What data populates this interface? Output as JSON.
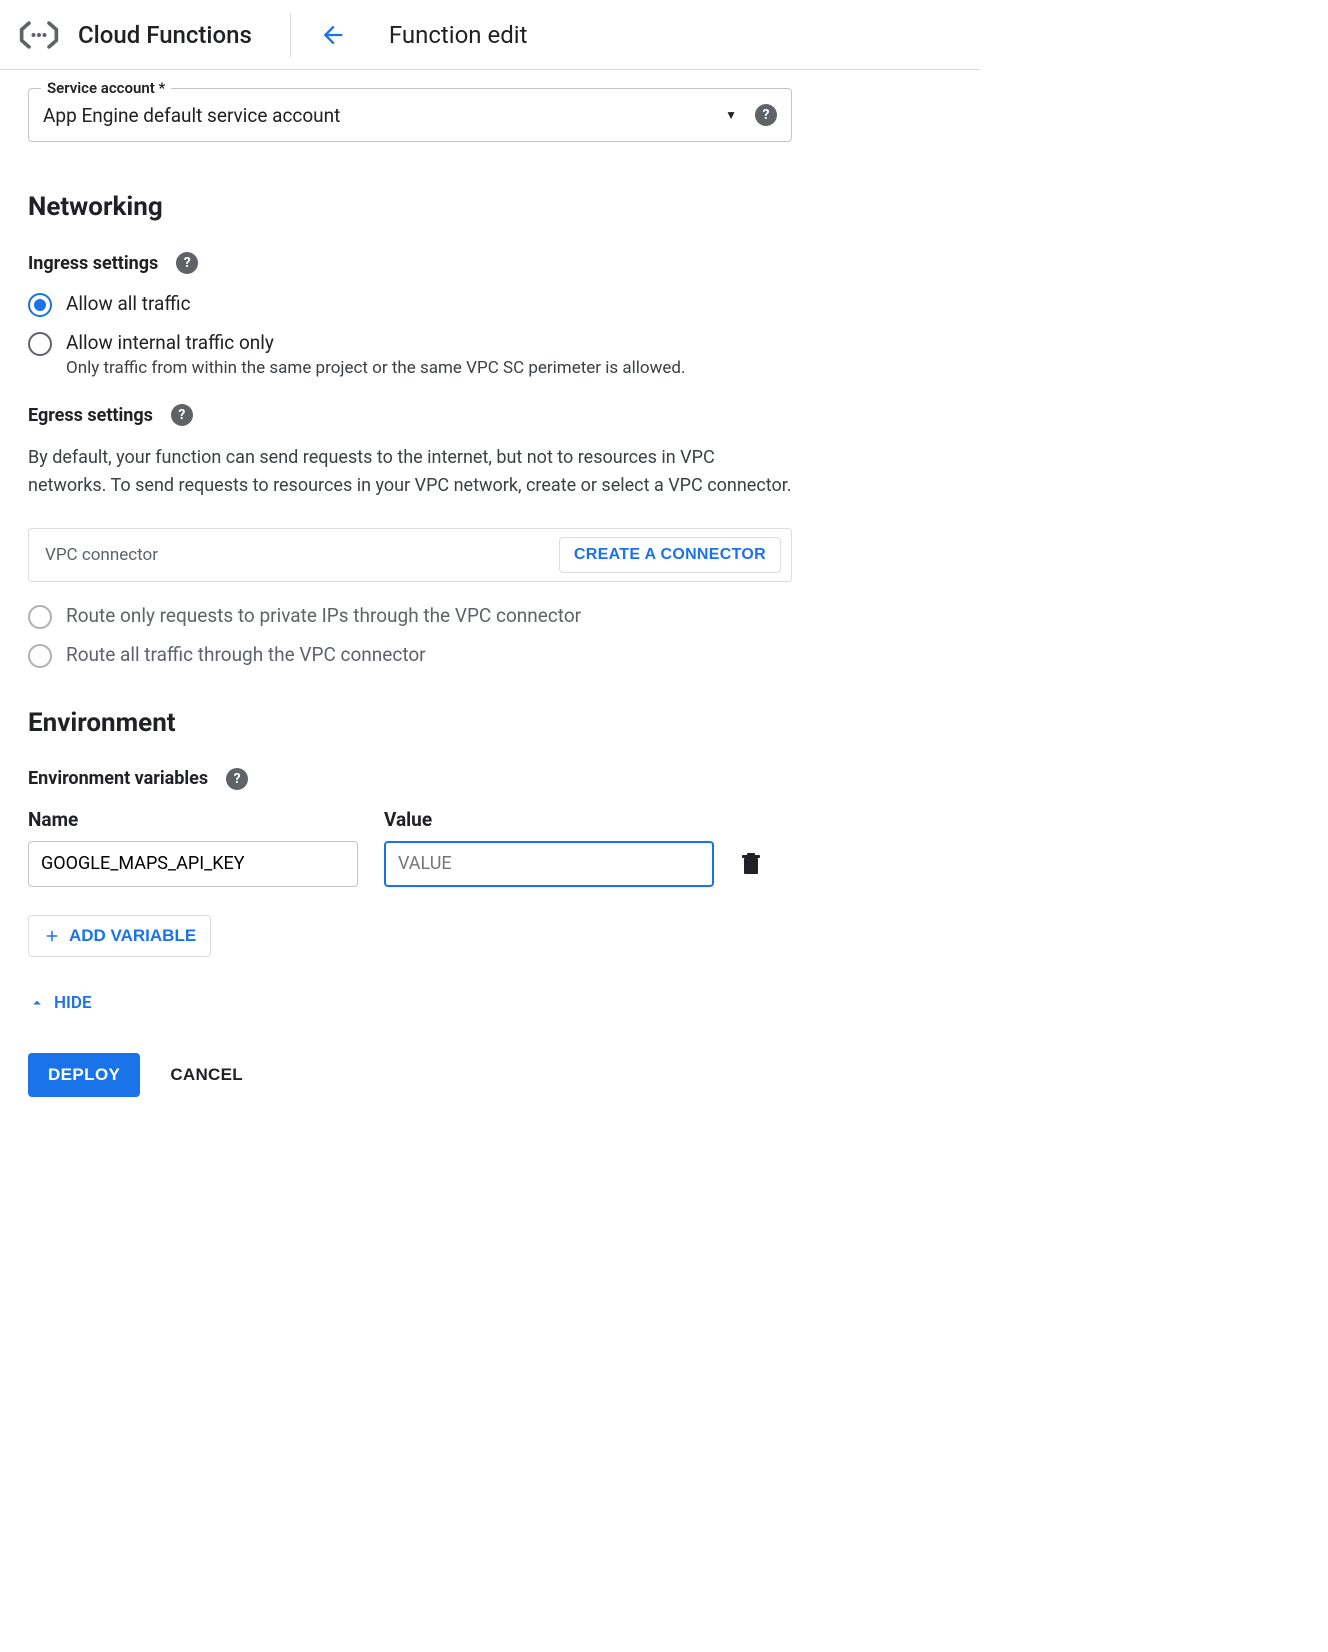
{
  "header": {
    "product": "Cloud Functions",
    "page": "Function edit"
  },
  "serviceAccount": {
    "label": "Service account *",
    "value": "App Engine default service account"
  },
  "networking": {
    "heading": "Networking",
    "ingress": {
      "label": "Ingress settings",
      "options": [
        {
          "label": "Allow all traffic",
          "selected": true
        },
        {
          "label": "Allow internal traffic only",
          "selected": false,
          "sub": "Only traffic from within the same project or the same VPC SC perimeter is allowed."
        }
      ]
    },
    "egress": {
      "label": "Egress settings",
      "description": "By default, your function can send requests to the internet, but not to resources in VPC networks. To send requests to resources in your VPC network, create or select a VPC connector.",
      "placeholder": "VPC connector",
      "createBtn": "CREATE A CONNECTOR",
      "options": [
        {
          "label": "Route only requests to private IPs through the VPC connector",
          "disabled": true
        },
        {
          "label": "Route all traffic through the VPC connector",
          "disabled": true
        }
      ]
    }
  },
  "environment": {
    "heading": "Environment",
    "subheading": "Environment variables",
    "columns": {
      "name": "Name",
      "value": "Value"
    },
    "vars": [
      {
        "name": "GOOGLE_MAPS_API_KEY",
        "value": "",
        "placeholder": "VALUE"
      }
    ],
    "addBtn": "ADD VARIABLE"
  },
  "hideLabel": "HIDE",
  "actions": {
    "deploy": "DEPLOY",
    "cancel": "CANCEL"
  }
}
